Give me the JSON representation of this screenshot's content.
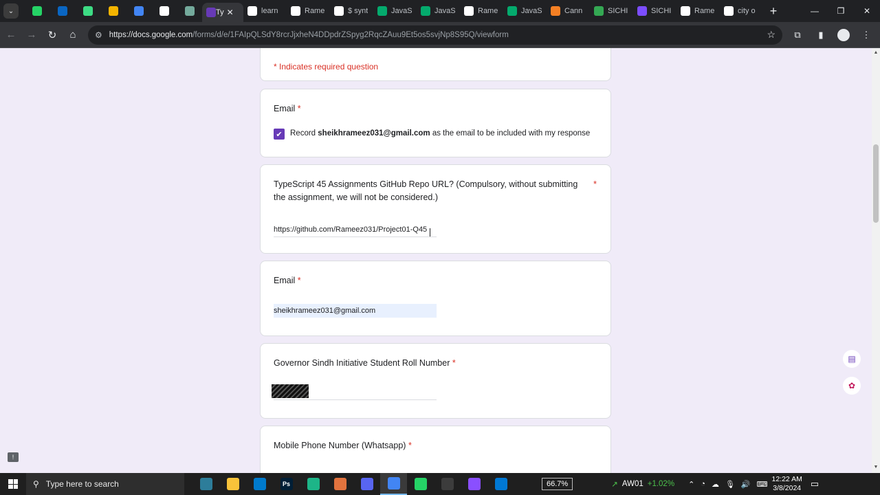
{
  "browser": {
    "tabs": [
      {
        "kind": "pinned",
        "icon": "whatsapp-icon",
        "color": "#25d366"
      },
      {
        "kind": "pinned",
        "icon": "linkedin-icon",
        "color": "#0a66c2"
      },
      {
        "kind": "pinned",
        "icon": "asterisk-icon",
        "color": "#3ddc84"
      },
      {
        "kind": "pinned",
        "icon": "slides-icon",
        "color": "#f4b400"
      },
      {
        "kind": "pinned",
        "icon": "translate-icon",
        "color": "#4285f4"
      },
      {
        "kind": "pinned",
        "icon": "github-icon",
        "color": "#ffffff"
      },
      {
        "kind": "pinned",
        "icon": "chatgpt-icon",
        "color": "#74aa9c"
      },
      {
        "kind": "active",
        "icon": "forms-icon",
        "color": "#673ab7",
        "title": "Ty"
      },
      {
        "kind": "normal",
        "icon": "github-icon",
        "color": "#ffffff",
        "title": "learn"
      },
      {
        "kind": "normal",
        "icon": "github-icon",
        "color": "#ffffff",
        "title": "Rame"
      },
      {
        "kind": "normal",
        "icon": "google-icon",
        "color": "#ffffff",
        "title": "$ synt"
      },
      {
        "kind": "normal",
        "icon": "w3-icon",
        "color": "#04aa6d",
        "title": "JavaS"
      },
      {
        "kind": "normal",
        "icon": "w3-icon",
        "color": "#04aa6d",
        "title": "JavaS"
      },
      {
        "kind": "normal",
        "icon": "github-icon",
        "color": "#ffffff",
        "title": "Rame"
      },
      {
        "kind": "normal",
        "icon": "w3-icon",
        "color": "#04aa6d",
        "title": "JavaS"
      },
      {
        "kind": "normal",
        "icon": "stackoverflow-icon",
        "color": "#f48024",
        "title": "Cann"
      },
      {
        "kind": "normal",
        "icon": "sichi-icon",
        "color": "#34a853",
        "title": "SICHI"
      },
      {
        "kind": "normal",
        "icon": "sichi-icon",
        "color": "#7c4dff",
        "title": "SICHI"
      },
      {
        "kind": "normal",
        "icon": "github-icon",
        "color": "#ffffff",
        "title": "Rame"
      },
      {
        "kind": "normal",
        "icon": "google-icon",
        "color": "#ffffff",
        "title": "city o"
      }
    ],
    "url_host": "https://docs.google.com",
    "url_path": "/forms/d/e/1FAIpQLSdY8rcrJjxheN4DDpdrZSpyg2RqcZAuu9Et5os5svjNp8S95Q/viewform"
  },
  "form": {
    "required_note": "* Indicates required question",
    "email_section": {
      "title": "Email",
      "asterisk": "*",
      "record_prefix": "Record ",
      "record_email": "sheikhrameez031@gmail.com",
      "record_suffix": " as the email to be included with my response",
      "checked": true
    },
    "q_repo": {
      "title": "TypeScript 45 Assignments GitHub Repo URL? (Compulsory, without submitting the assignment, we will not be considered.)",
      "asterisk": "*",
      "answer": "https://github.com/Rameez031/Project01-Q45"
    },
    "q_email": {
      "title": "Email",
      "asterisk": "*",
      "answer": "sheikhrameez031@gmail.com"
    },
    "q_roll": {
      "title": "Governor Sindh Initiative Student Roll Number",
      "asterisk": "*"
    },
    "q_phone": {
      "title": "Mobile Phone Number (Whatsapp)",
      "asterisk": "*"
    }
  },
  "taskbar": {
    "search_placeholder": "Type here to search",
    "apps": [
      {
        "icon": "calculator-icon",
        "color": "#2d7d9a"
      },
      {
        "icon": "file-explorer-icon",
        "color": "#f8c33a"
      },
      {
        "icon": "vscode-icon",
        "color": "#007acc"
      },
      {
        "icon": "photoshop-icon",
        "color": "#001e36",
        "label": "Ps"
      },
      {
        "icon": "app-green-icon",
        "color": "#1db588"
      },
      {
        "icon": "git-icon",
        "color": "#e2733e"
      },
      {
        "icon": "discord-icon",
        "color": "#5865f2"
      },
      {
        "icon": "chrome-icon",
        "color": "#4285f4",
        "active": true
      },
      {
        "icon": "whatsapp-icon",
        "color": "#25d366"
      },
      {
        "icon": "terminal-icon",
        "color": "#3c3c3c"
      },
      {
        "icon": "app-purple-icon",
        "color": "#8a4fff"
      },
      {
        "icon": "app-blue-icon",
        "color": "#0078d4"
      }
    ],
    "zoom": "66.7%",
    "stock_name": "AW01",
    "stock_change": "+1.02%",
    "time": "12:22 AM",
    "date": "3/8/2024"
  }
}
